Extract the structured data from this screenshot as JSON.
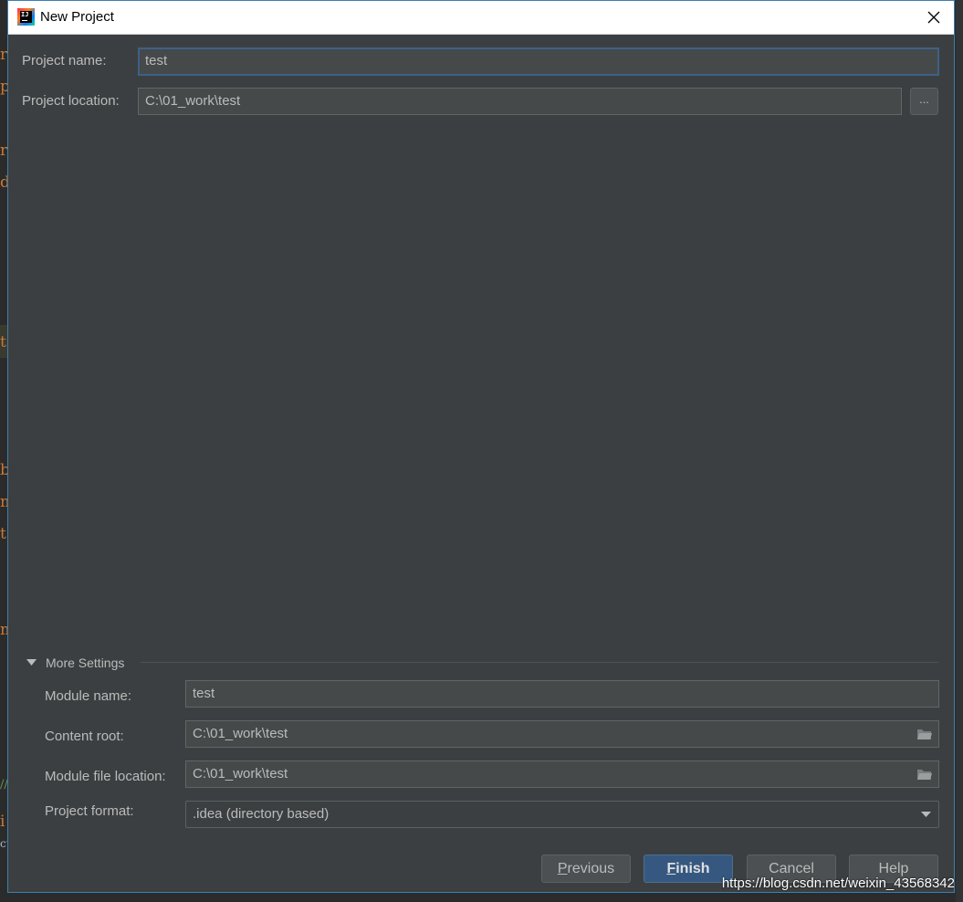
{
  "window": {
    "title": "New Project",
    "app_icon": "intellij-idea-icon",
    "close_icon": "close-icon"
  },
  "background_editor": {
    "glyphs": [
      "r",
      "p",
      "r",
      "d",
      "t",
      "b",
      "m",
      "t",
      "m",
      "//",
      "i",
      "cu"
    ]
  },
  "form": {
    "project_name_label": "Project name:",
    "project_name_value": "test",
    "project_location_label": "Project location:",
    "project_location_value": "C:\\01_work\\test",
    "browse_label": "..."
  },
  "more_settings": {
    "title": "More Settings",
    "expanded": true,
    "module_name_label": "Module name:",
    "module_name_value": "test",
    "content_root_label": "Content root:",
    "content_root_value": "C:\\01_work\\test",
    "module_file_location_label": "Module file location:",
    "module_file_location_value": "C:\\01_work\\test",
    "project_format_label": "Project format:",
    "project_format_value": ".idea (directory based)"
  },
  "buttons": {
    "previous": {
      "mnemonic": "P",
      "rest": "revious"
    },
    "finish": {
      "mnemonic": "F",
      "rest": "inish"
    },
    "cancel": "Cancel",
    "help": "Help"
  },
  "watermark": "https://blog.csdn.net/weixin_43568342",
  "colors": {
    "dialog_bg": "#3c3f41",
    "field_bg": "#45494a",
    "focus_border": "#3d6185",
    "primary_button": "#365880",
    "text": "#bbbbbb"
  }
}
